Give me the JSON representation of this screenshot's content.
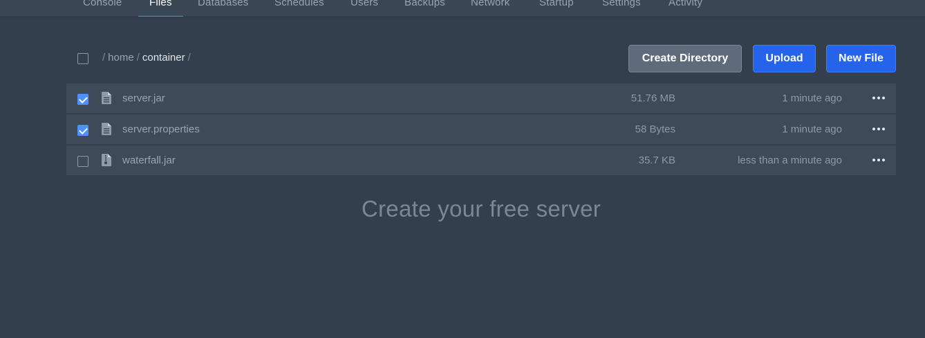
{
  "nav": {
    "tabs": [
      {
        "label": "Console"
      },
      {
        "label": "Files",
        "active": true
      },
      {
        "label": "Databases"
      },
      {
        "label": "Schedules"
      },
      {
        "label": "Users"
      },
      {
        "label": "Backups"
      },
      {
        "label": "Network"
      },
      {
        "label": "Startup"
      },
      {
        "label": "Settings"
      },
      {
        "label": "Activity"
      }
    ]
  },
  "breadcrumb": {
    "sep": "/",
    "home": "home",
    "current": "container"
  },
  "toolbar": {
    "create_directory": "Create Directory",
    "upload": "Upload",
    "new_file": "New File"
  },
  "files": [
    {
      "name": "server.jar",
      "size": "51.76 MB",
      "modified": "1 minute ago",
      "checked": true,
      "icon": "file-text-icon"
    },
    {
      "name": "server.properties",
      "size": "58 Bytes",
      "modified": "1 minute ago",
      "checked": true,
      "icon": "file-text-icon"
    },
    {
      "name": "waterfall.jar",
      "size": "35.7 KB",
      "modified": "less than a minute ago",
      "checked": false,
      "icon": "file-archive-icon"
    }
  ],
  "promo": "Create your free server",
  "colors": {
    "background": "#333f4d",
    "row": "#3e4a57",
    "accent_blue": "#2563eb",
    "tab_underline": "#22b8cf"
  }
}
